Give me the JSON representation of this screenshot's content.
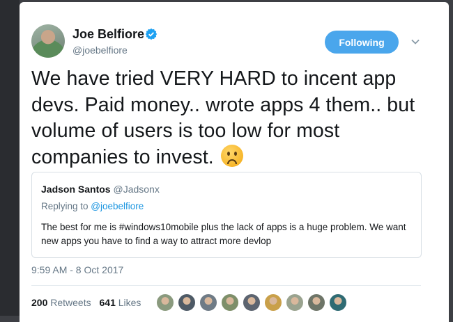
{
  "tweet": {
    "author": {
      "name": "Joe Belfiore",
      "handle": "@joebelfiore",
      "verified": true
    },
    "follow_label": "Following",
    "text": "We have tried VERY HARD to incent app devs. Paid money.. wrote apps 4 them.. but volume of users is too low for most companies to invest.",
    "emoji": "slightly-frowning-face",
    "quote": {
      "name": "Jadson Santos",
      "handle": "@Jadsonx",
      "reply_prefix": "Replying to ",
      "reply_to": "@joebelfiore",
      "text": "The best for me is #windows10mobile  plus the lack of apps is a huge problem. We want new apps you have to find a way to attract more devlop"
    },
    "timestamp": "9:59 AM - 8 Oct 2017",
    "stats": {
      "retweets_count": "200",
      "retweets_label": "Retweets",
      "likes_count": "641",
      "likes_label": "Likes"
    },
    "liker_avatars": [
      "#8a9a7e",
      "#4e5a66",
      "#6f7b86",
      "#7e8f6a",
      "#5c6470",
      "#c9a04a",
      "#9aa38f",
      "#6e7568",
      "#2f6b73"
    ]
  },
  "colors": {
    "accent": "#1da1f2",
    "follow_button": "#4aa6ec",
    "text": "#14171a",
    "muted": "#657786"
  }
}
